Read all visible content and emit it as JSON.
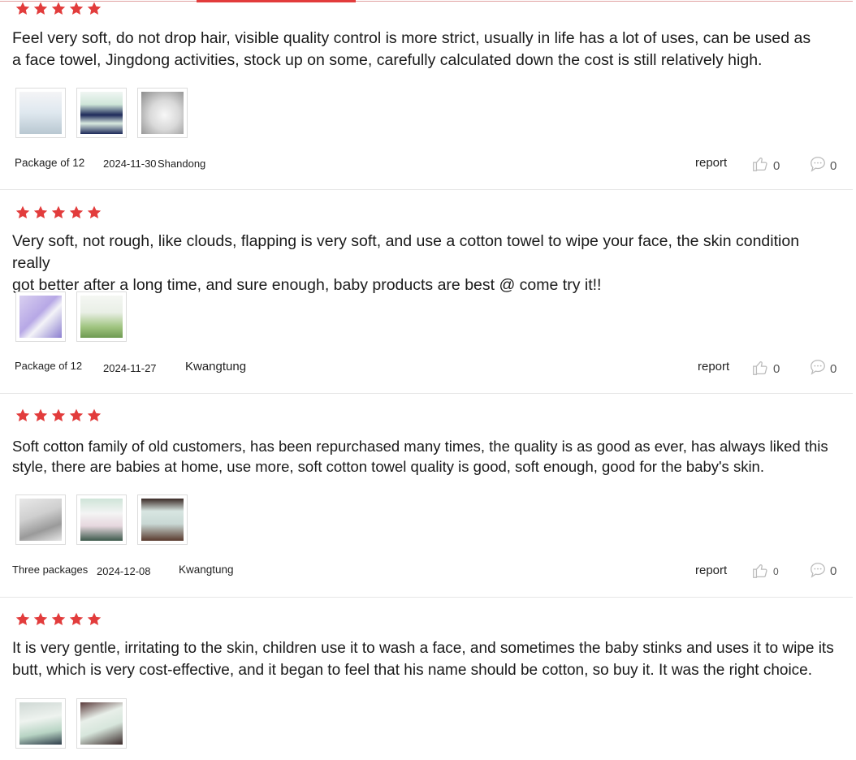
{
  "reviews": [
    {
      "rating": 5,
      "text": "Feel very soft, do not drop hair, visible quality control is more strict, usually in life has a lot of uses, can be used as\n a face towel, Jingdong activities, stock up on some, carefully calculated down the cost is still relatively high.",
      "variant": "Package of 12",
      "date": "2024-11-30",
      "location": "Shandong",
      "report_label": "report",
      "likes": "0",
      "comments": "0",
      "images": [
        "wipes-package-photo",
        "wipes-stack-photo",
        "wipe-in-hand-photo"
      ]
    },
    {
      "rating": 5,
      "text": "Very soft, not rough, like clouds, flapping is very soft, and use a cotton towel to wipe your face, the skin condition really\n got better after a long time, and sure enough, baby products are best @ come try it!!",
      "variant": "Package of 12",
      "date": "2024-11-27",
      "location": "Kwangtung",
      "report_label": "report",
      "likes": "0",
      "comments": "0",
      "images": [
        "wipes-package-purple-photo",
        "wipes-package-green-photo"
      ]
    },
    {
      "rating": 5,
      "text": "Soft cotton family of old customers, has been repurchased many times, the quality is as good as ever, has always liked this\nstyle, there are babies at home, use more, soft cotton towel quality is good, soft enough, good for the baby's skin.",
      "variant": "Three packages",
      "date": "2024-12-08",
      "location": "Kwangtung",
      "report_label": "report",
      "likes": "0",
      "comments": "0",
      "images": [
        "wipe-texture-photo",
        "wipes-open-pack-photo",
        "wipes-box-photo"
      ]
    },
    {
      "rating": 5,
      "text": "It is very gentle, irritating to the skin, children use it to wash a face, and sometimes the baby stinks and uses it to wipe its\n butt, which is very cost-effective, and it began to feel that his name should be cotton, so buy it. It was the right choice.",
      "images": [
        "wipes-pack-closeup-photo",
        "wipe-pulled-out-photo"
      ]
    }
  ],
  "colors": {
    "star": "#e23c3c",
    "accent": "#e23c3c",
    "divider": "#e6e6e6"
  }
}
